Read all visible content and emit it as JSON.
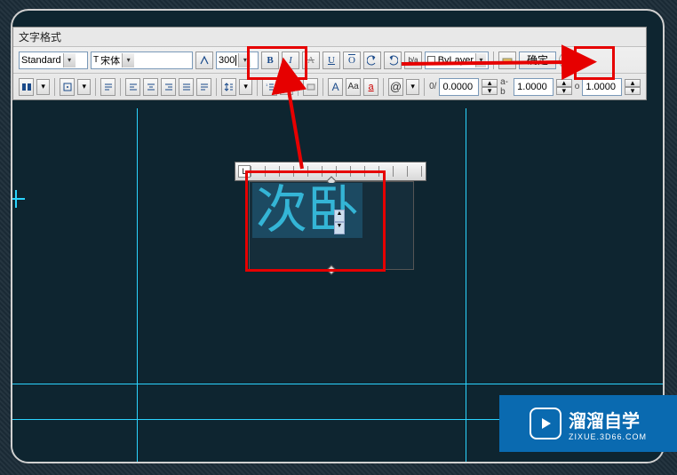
{
  "panel": {
    "title": "文字格式"
  },
  "toolbar1": {
    "style": "Standard",
    "font": "宋体",
    "size": "300",
    "boldGlyph": "B",
    "italicGlyph": "I",
    "underlineGlyph": "U",
    "overlineGlyph": "O",
    "strikeGlyph": "A",
    "colorLayer": "ByLayer",
    "ok": "确定"
  },
  "toolbar2": {
    "at": "@",
    "obliqueVal": "0.0000",
    "trackingVal": "1.0000",
    "widthFactorVal": "1.0000",
    "fontAa": "Aa",
    "fontCapA": "A",
    "lowercase": "a",
    "fraction": "b/a",
    "oblique": "0/",
    "tracking": "a-b",
    "widthFactor": "o"
  },
  "canvas": {
    "mtText": "次卧",
    "rulerTab": "L"
  },
  "watermark": {
    "big": "溜溜自学",
    "small": "ZIXUE.3D66.COM"
  },
  "chart_data": null
}
